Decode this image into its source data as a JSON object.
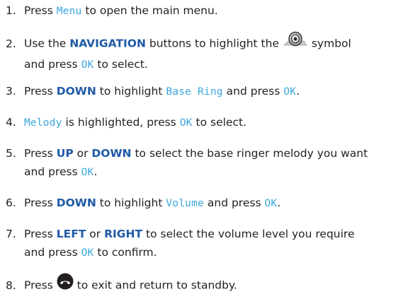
{
  "steps": [
    {
      "num": "1.",
      "parts": [
        {
          "t": "Press "
        },
        {
          "t": "Menu",
          "style": "lcd"
        },
        {
          "t": " to open the main menu."
        }
      ]
    },
    {
      "num": "2.",
      "parts": [
        {
          "t": "Use the "
        },
        {
          "t": "NAVIGATION",
          "style": "kw"
        },
        {
          "t": " buttons to highlight the "
        },
        {
          "icon": "speaker-icon"
        },
        {
          "t": " symbol"
        },
        {
          "br": true
        },
        {
          "t": "and press "
        },
        {
          "t": "OK",
          "style": "lcd"
        },
        {
          "t": " to select."
        }
      ]
    },
    {
      "num": "3.",
      "parts": [
        {
          "t": "Press "
        },
        {
          "t": "DOWN",
          "style": "kw"
        },
        {
          "t": " to highlight "
        },
        {
          "t": "Base Ring",
          "style": "lcd"
        },
        {
          "t": " and press "
        },
        {
          "t": "OK",
          "style": "lcd"
        },
        {
          "t": "."
        }
      ]
    },
    {
      "num": "4.",
      "parts": [
        {
          "t": "Melody",
          "style": "lcd"
        },
        {
          "t": " is highlighted, press "
        },
        {
          "t": "OK",
          "style": "lcd"
        },
        {
          "t": " to select."
        }
      ]
    },
    {
      "num": "5.",
      "parts": [
        {
          "t": "Press "
        },
        {
          "t": "UP",
          "style": "kw"
        },
        {
          "t": " or "
        },
        {
          "t": "DOWN",
          "style": "kw"
        },
        {
          "t": " to select the base ringer melody you want"
        },
        {
          "br": true
        },
        {
          "t": "and press "
        },
        {
          "t": "OK",
          "style": "lcd"
        },
        {
          "t": "."
        }
      ]
    },
    {
      "num": "6.",
      "parts": [
        {
          "t": "Press "
        },
        {
          "t": "DOWN",
          "style": "kw"
        },
        {
          "t": " to highlight "
        },
        {
          "t": "Volume",
          "style": "lcd"
        },
        {
          "t": " and press "
        },
        {
          "t": "OK",
          "style": "lcd"
        },
        {
          "t": "."
        }
      ]
    },
    {
      "num": "7.",
      "parts": [
        {
          "t": "Press "
        },
        {
          "t": "LEFT",
          "style": "kw"
        },
        {
          "t": " or "
        },
        {
          "t": "RIGHT",
          "style": "kw"
        },
        {
          "t": " to select the volume level you require"
        },
        {
          "br": true
        },
        {
          "t": "and press "
        },
        {
          "t": "OK",
          "style": "lcd"
        },
        {
          "t": " to confirm."
        }
      ]
    },
    {
      "num": "8.",
      "parts": [
        {
          "t": "Press "
        },
        {
          "icon": "end-call-icon"
        },
        {
          "t": " to exit and return to standby."
        }
      ]
    }
  ]
}
